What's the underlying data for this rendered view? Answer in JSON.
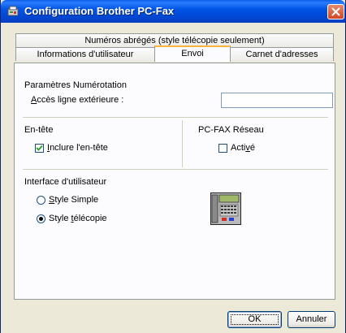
{
  "window": {
    "title": "Configuration Brother PC-Fax"
  },
  "tabs": {
    "top": [
      {
        "label": "Numéros abrégés (style télécopie seulement)"
      }
    ],
    "bottom": [
      {
        "label": "Informations d'utilisateur"
      },
      {
        "label": "Envoi",
        "active": true
      },
      {
        "label": "Carnet d'adresses"
      }
    ]
  },
  "dialing": {
    "section_title": "Paramètres Numérotation",
    "outside_line_label_first": "A",
    "outside_line_label_rest": "ccès ligne extérieure :",
    "outside_line_value": ""
  },
  "header": {
    "section_title": "En-tête",
    "include_label_first": "I",
    "include_label_rest": "nclure l'en-tête",
    "include_checked": true
  },
  "network": {
    "section_title": "PC-FAX Réseau",
    "activate_label_pre": "Acti",
    "activate_label_u": "v",
    "activate_label_post": "é",
    "activate_checked": false
  },
  "ui": {
    "section_title": "Interface d'utilisateur",
    "option1_first": "S",
    "option1_rest": "tyle Simple",
    "option2_pre": "Style ",
    "option2_u": "t",
    "option2_post": "élécopie",
    "selected": "fax-style"
  },
  "buttons": {
    "ok": "OK",
    "cancel": "Annuler"
  },
  "colors": {
    "titlebar": "#0055e5",
    "face": "#ece9d8",
    "tab_highlight": "#f8b33a",
    "radio_dot": "#21a121"
  }
}
